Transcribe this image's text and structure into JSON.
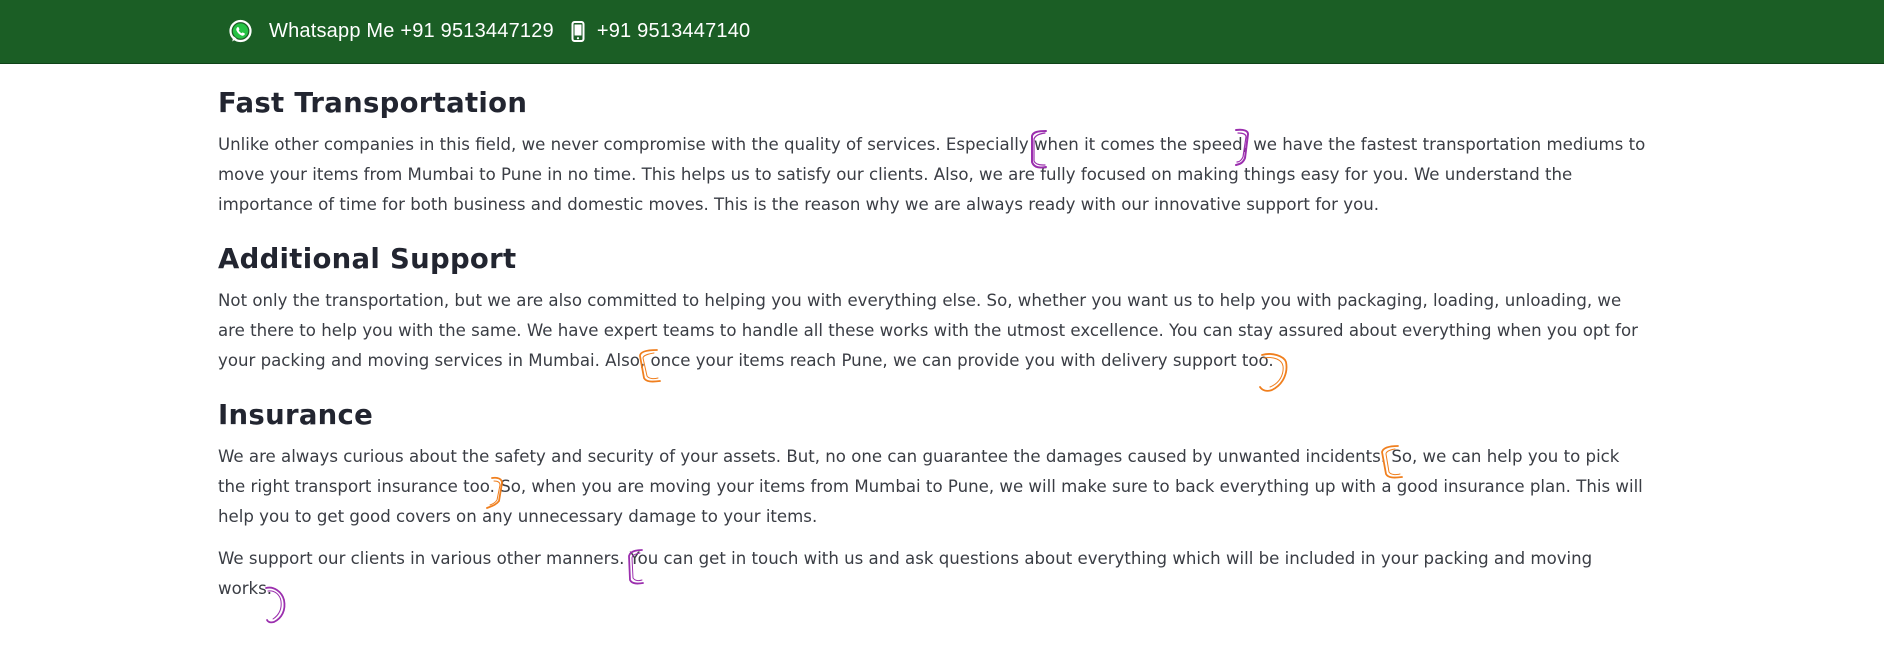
{
  "topbar": {
    "whatsapp_text": "Whatsapp Me +91 9513447129",
    "phone_text": "+91 9513447140",
    "icons": {
      "whatsapp": "whatsapp-icon",
      "phone": "mobile-phone-icon"
    },
    "background": "#1b5e25"
  },
  "sections": {
    "fast": {
      "title": "Fast Transportation",
      "body": "Unlike other companies in this field, we never compromise with the quality of services. Especially when it comes the speed, we have the fastest transportation mediums to move your items from Mumbai to Pune in no time. This helps us to satisfy our clients. Also, we are fully focused on making things easy for you. We understand the importance of time for both business and domestic moves. This is the reason why we are always ready with our innovative support for you."
    },
    "additional": {
      "title": "Additional Support",
      "body": "Not only the transportation, but we are also committed to helping you with everything else. So, whether you want us to help you with packaging, loading, unloading, we are there to help you with the same. We have expert teams to handle all these works with the utmost excellence. You can stay assured about everything when you opt for your packing and moving services in Mumbai. Also, once your items reach Pune, we can provide you with delivery support too."
    },
    "insurance": {
      "title": "Insurance",
      "body": "We are always curious about the safety and security of your assets. But, no one can guarantee the damages caused by unwanted incidents. So, we can help you to pick the right transport insurance too. So, when you are moving your items from Mumbai to Pune, we will make sure to back everything up with a good insurance plan. This will help you to get good covers on any unnecessary damage to your items."
    },
    "support": {
      "body": "We support our clients in various other manners. You can get in touch with us and ask questions about everything which will be included in your packing and moving works."
    }
  },
  "annotations": {
    "purple": "#9b2fae",
    "orange": "#f07f1e"
  }
}
